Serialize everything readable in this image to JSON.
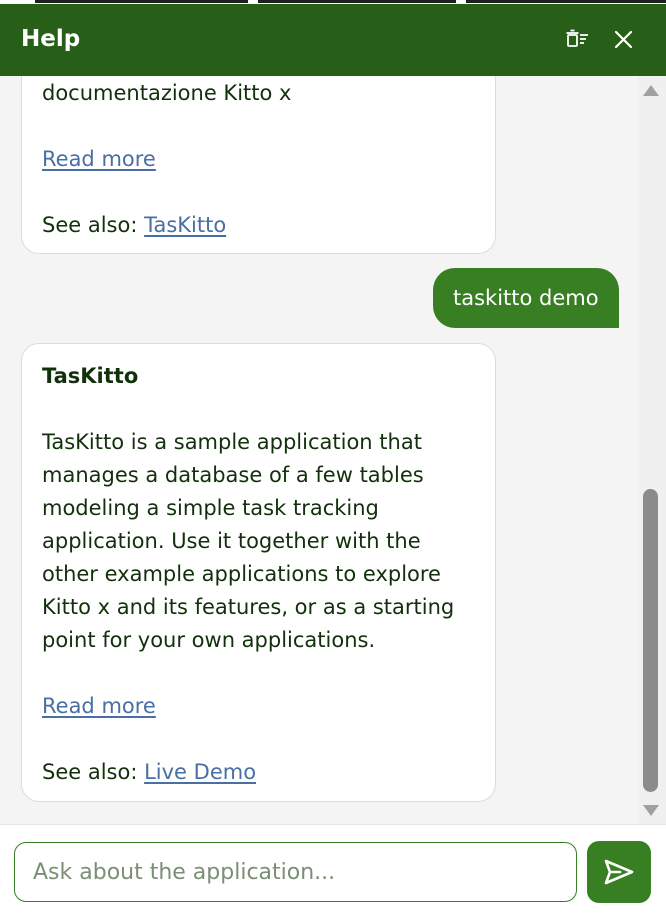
{
  "header": {
    "title": "Help",
    "clear_icon": "clear-history-icon",
    "close_icon": "close-icon",
    "background": "#275e18"
  },
  "messages": [
    {
      "role": "assistant",
      "truncated_text": "documentazione Kitto x",
      "read_more": "Read more",
      "see_also_label": "See also: ",
      "see_also_link": "TasKitto"
    },
    {
      "role": "user",
      "text": "taskitto demo"
    },
    {
      "role": "assistant",
      "title": "TasKitto",
      "text": "TasKitto is a sample application that manages a database of a few tables modeling a simple task tracking application. Use it together with the other example applications to explore Kitto x and its features, or as a starting point for your own applications.",
      "read_more": "Read more",
      "see_also_label": "See also: ",
      "see_also_link": "Live Demo"
    }
  ],
  "input": {
    "placeholder": "Ask about the application...",
    "value": ""
  },
  "send": {
    "icon": "send-icon",
    "color": "#387e22"
  }
}
